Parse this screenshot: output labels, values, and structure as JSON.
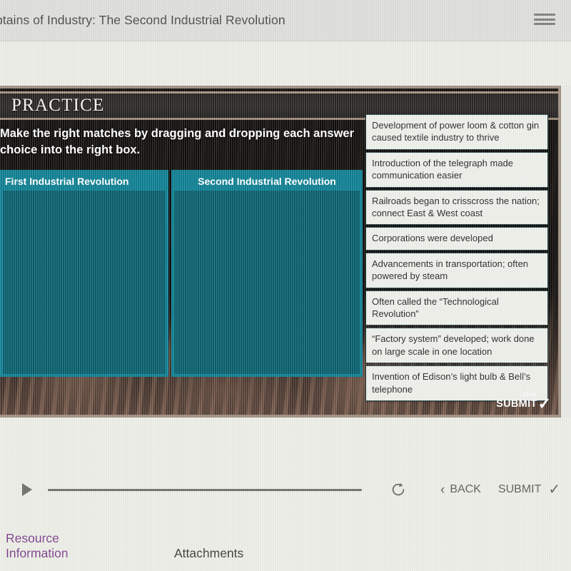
{
  "header": {
    "title": "ptains of Industry: The Second Industrial Revolution",
    "menu_icon": "hamburger-menu-icon"
  },
  "slide": {
    "banner_label": "PRACTICE",
    "instructions": "Make the right matches by dragging and dropping each answer choice into the right box.",
    "dropzones": [
      {
        "label": "First Industrial Revolution",
        "items": []
      },
      {
        "label": "Second Industrial Revolution",
        "items": []
      }
    ],
    "choices": [
      "Development of power loom & cotton gin caused textile industry to thrive",
      "Introduction of the telegraph made communication easier",
      "Railroads began to crisscross the nation; connect East & West coast",
      "Corporations were developed",
      "Advancements in transportation; often powered by steam",
      "Often called the “Technological Revolution”",
      "“Factory system” developed; work done on large scale in one location",
      "Invention of Edison’s light bulb & Bell’s telephone"
    ],
    "submit_badge": {
      "click_label": "Click",
      "submit_label": "SUBMIT",
      "check_glyph": "✓"
    },
    "colors": {
      "dropzone_teal": "#0e7f92",
      "dropzone_inner": "#0a5f6d",
      "card_background": "#eef0ea",
      "frame_border": "#a08f82"
    }
  },
  "toolbar": {
    "play_icon": "play-icon",
    "refresh_icon": "refresh-icon",
    "back_label": "BACK",
    "back_chevron": "‹",
    "submit_label": "SUBMIT",
    "submit_check": "✓"
  },
  "footer": {
    "resource_line1": "Resource",
    "resource_line2": "Information",
    "attachments_label": "Attachments",
    "resource_color": "#7e3f8f"
  }
}
